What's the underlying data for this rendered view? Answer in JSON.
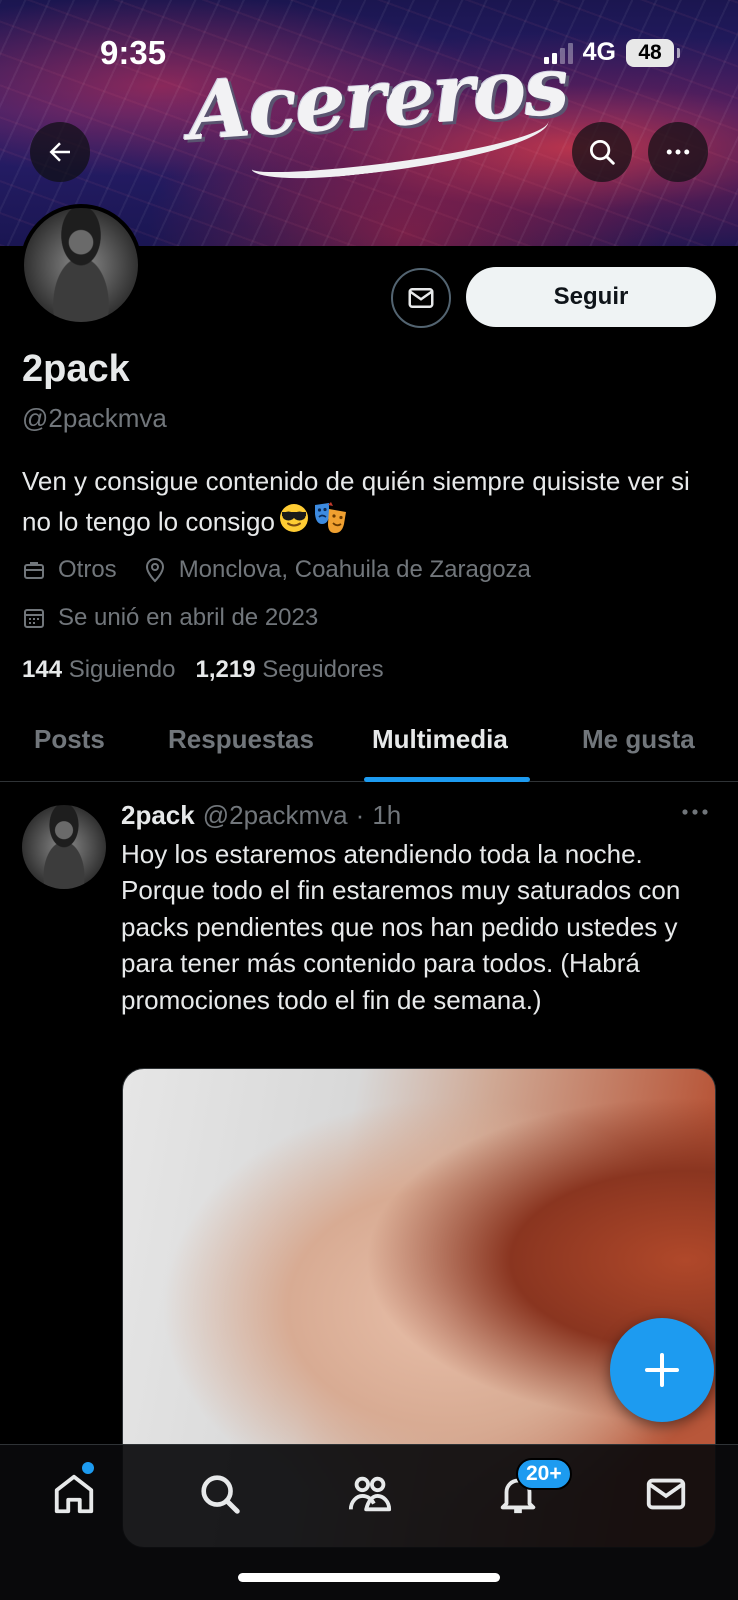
{
  "status_bar": {
    "time": "9:35",
    "network": "4G",
    "battery": "48"
  },
  "banner": {
    "logo_text": "Acereros"
  },
  "profile": {
    "follow_label": "Seguir",
    "display_name": "2pack",
    "handle": "@2packmva",
    "bio": "Ven y consigue contenido de quién siempre quisiste ver si no lo tengo lo consigo",
    "bio_emojis": [
      "smiling-face-with-sunglasses",
      "performing-arts"
    ],
    "category": "Otros",
    "location": "Monclova, Coahuila de Zaragoza",
    "joined": "Se unió en abril de 2023",
    "following_count": "144",
    "following_label": "Siguiendo",
    "followers_count": "1,219",
    "followers_label": "Seguidores"
  },
  "tabs": [
    {
      "label": "Posts",
      "active": false
    },
    {
      "label": "Respuestas",
      "active": false
    },
    {
      "label": "Multimedia",
      "active": true
    },
    {
      "label": "Me gusta",
      "active": false
    }
  ],
  "post": {
    "author_name": "2pack",
    "author_handle": "@2packmva",
    "separator": "·",
    "time": "1h",
    "text": "Hoy los estaremos atendiendo toda la noche. Porque todo el fin estaremos muy saturados con packs pendientes que nos han pedido ustedes y para tener más contenido para todos. (Habrá promociones todo el fin de semana.)"
  },
  "bottom_nav": {
    "items": [
      "home-icon",
      "search-icon",
      "communities-icon",
      "notifications-icon",
      "messages-icon"
    ],
    "notifications_badge": "20+"
  },
  "colors": {
    "accent": "#1d9bf0",
    "background": "#000000",
    "text": "#e7e9ea",
    "secondary_text": "#71767b",
    "border": "#2f3336"
  }
}
